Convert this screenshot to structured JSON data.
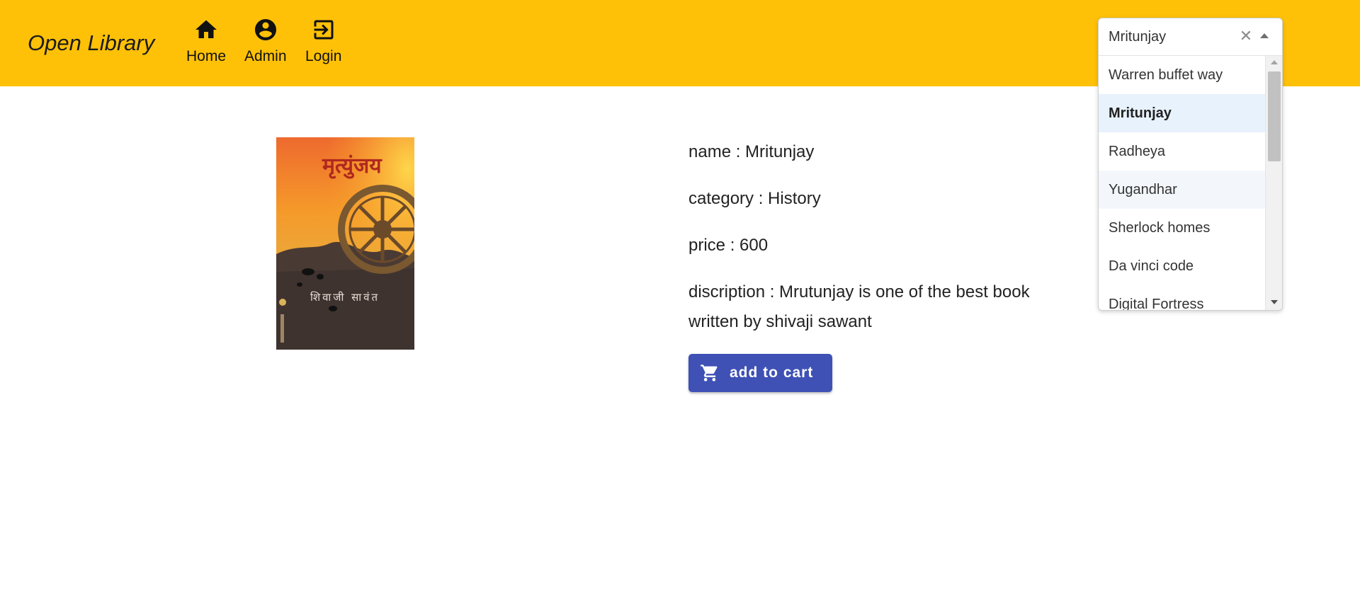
{
  "colors": {
    "appbar": "#FFC107",
    "button": "#3F51B5",
    "selected_option": "#E8F2FD"
  },
  "header": {
    "brand": "Open Library",
    "nav": [
      {
        "label": "Home",
        "icon": "home-icon"
      },
      {
        "label": "Admin",
        "icon": "account-circle-icon"
      },
      {
        "label": "Login",
        "icon": "login-icon"
      }
    ]
  },
  "search": {
    "value": "Mritunjay",
    "clear_icon": "close-icon",
    "toggle_icon": "arrow-up-icon",
    "options": [
      "Warren buffet way",
      "Mritunjay",
      "Radheya",
      "Yugandhar",
      "Sherlock homes",
      "Da vinci code",
      "Digital Fortress"
    ],
    "selected_option": "Mritunjay",
    "hovered_option": "Yugandhar"
  },
  "book": {
    "cover_title": "मृत्युंजय",
    "cover_author": "शिवाजी सावंत",
    "name_line": "name : Mritunjay",
    "category_line": "category : History",
    "price_line": "price : 600",
    "description_line": "discription : Mrutunjay is one of the best book written by shivaji sawant"
  },
  "actions": {
    "add_to_cart": "add to cart",
    "cart_icon": "shopping-cart-icon"
  }
}
